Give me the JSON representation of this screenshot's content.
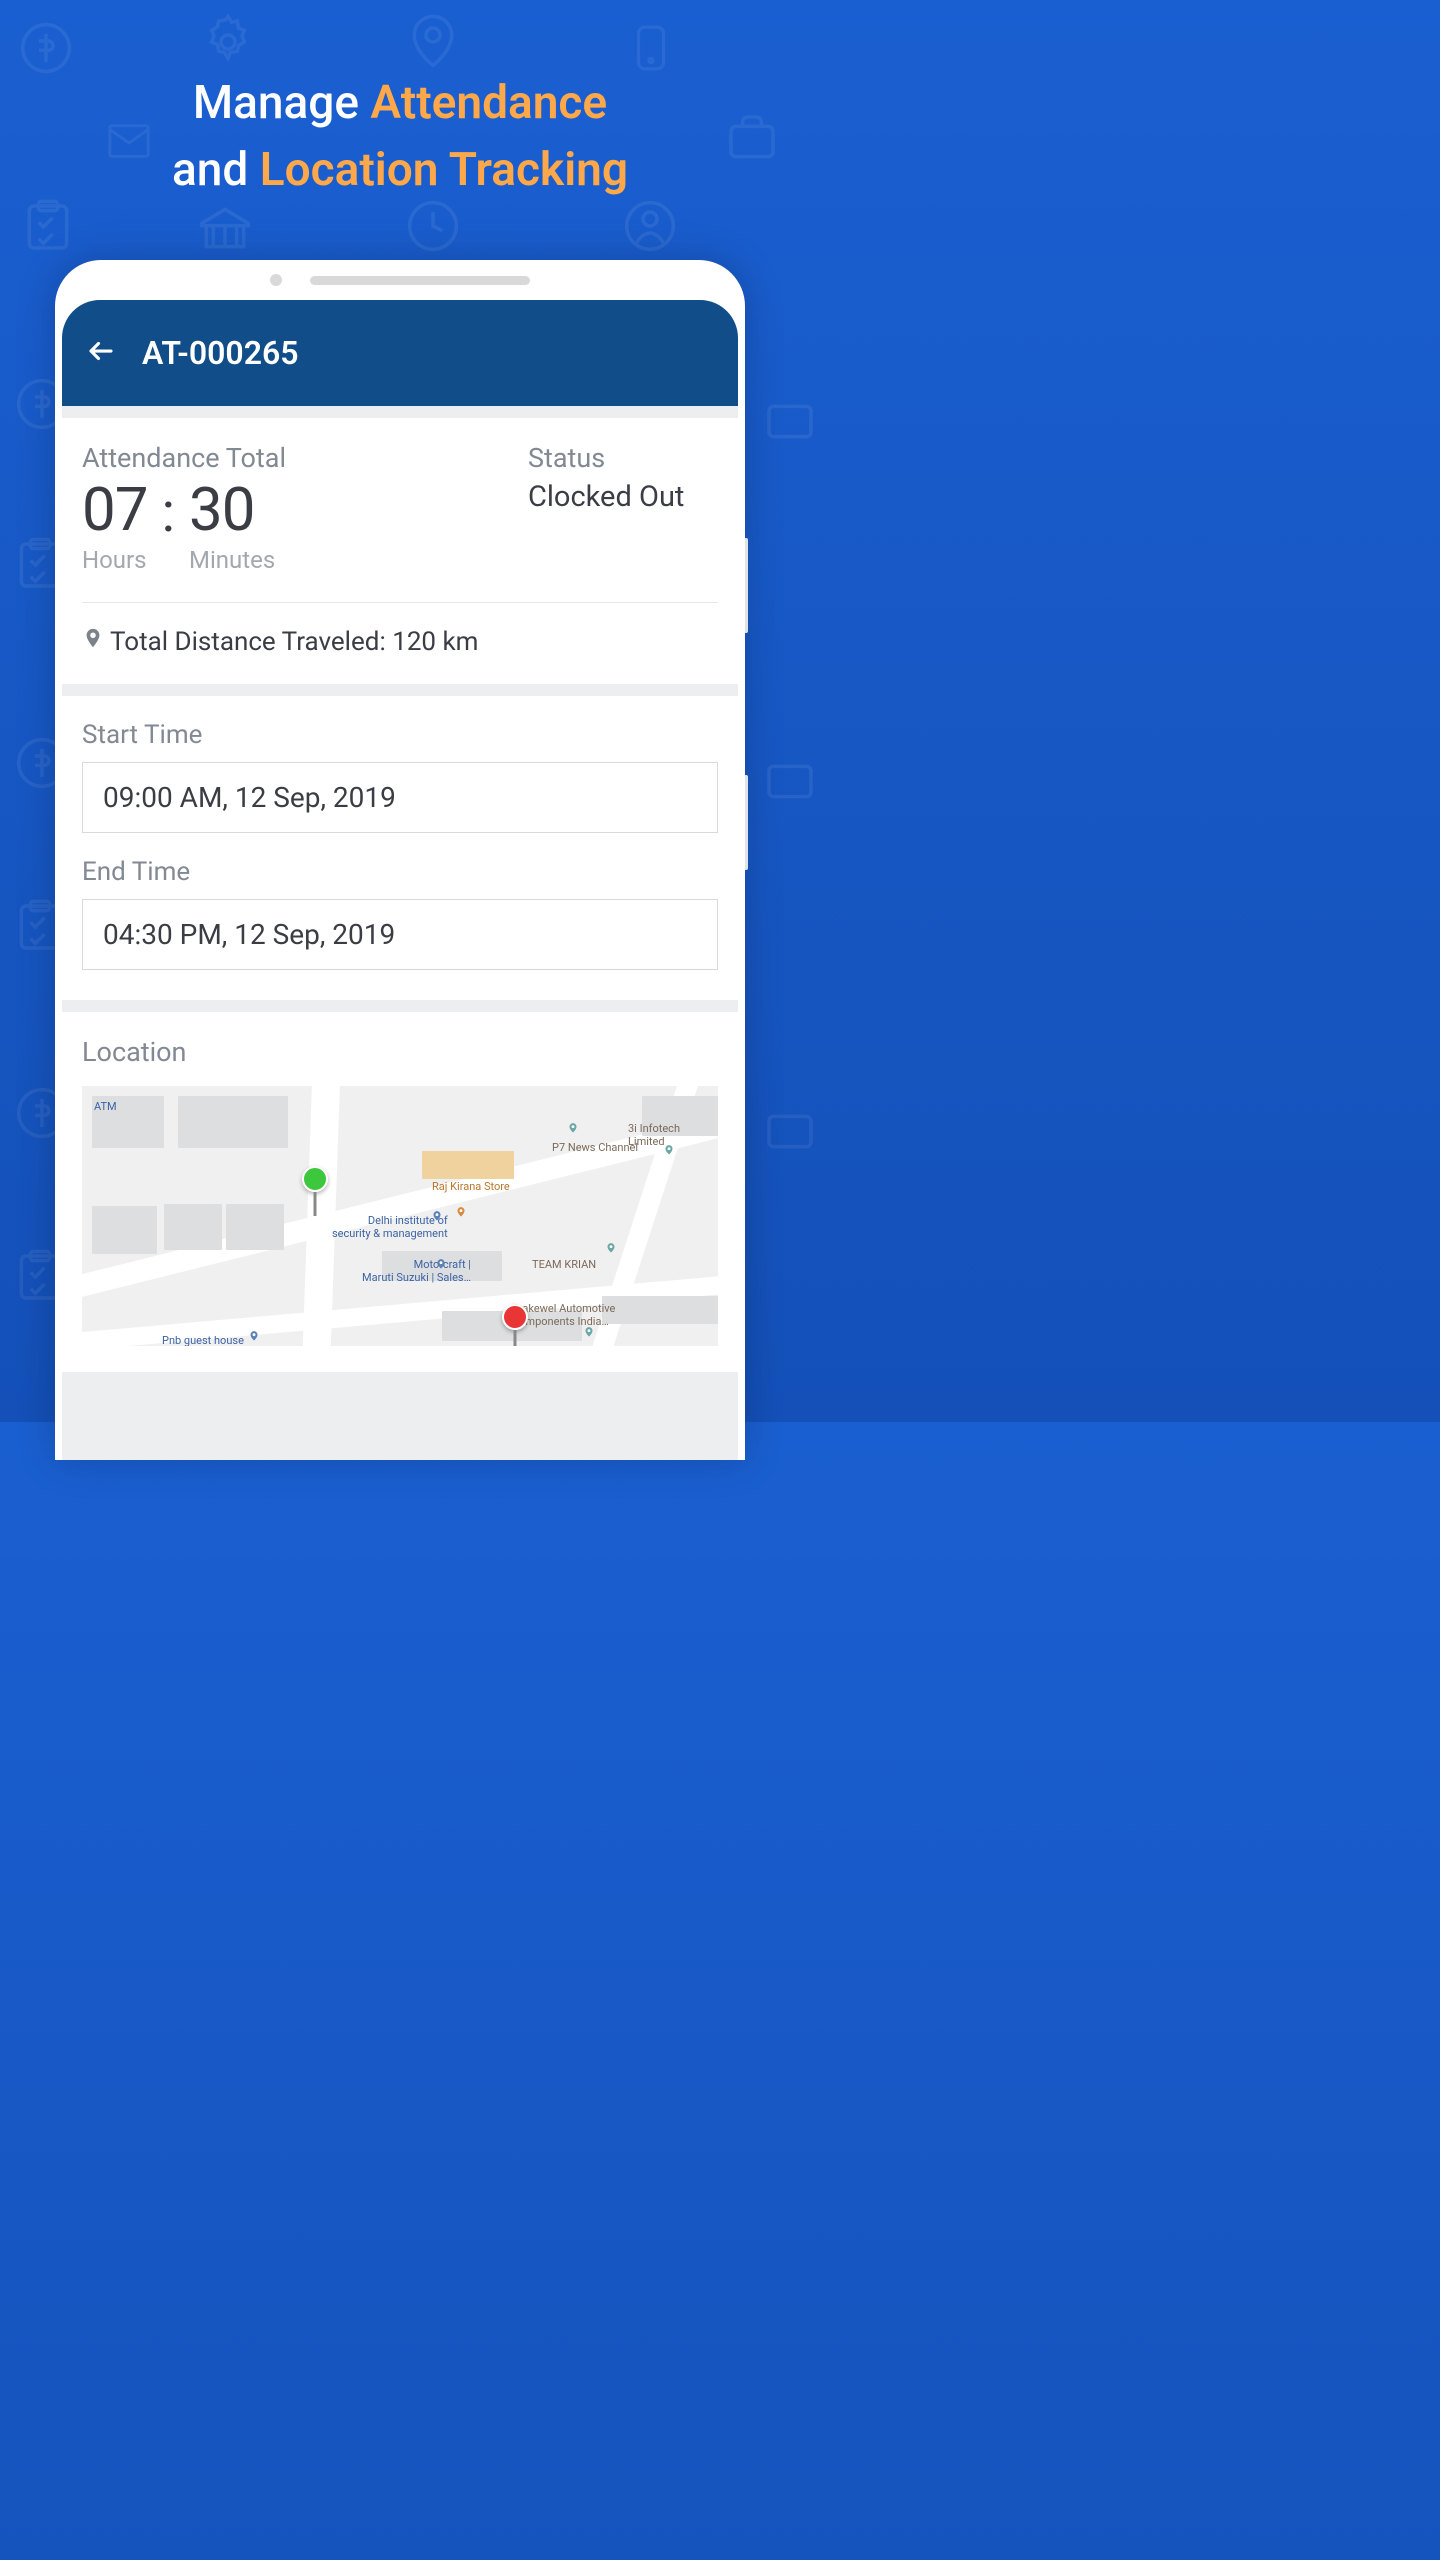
{
  "headline": {
    "p1": "Manage ",
    "h1": "Attendance",
    "p2": "and ",
    "h2": "Location Tracking"
  },
  "appbar": {
    "title": "AT-000265"
  },
  "attendance": {
    "label": "Attendance Total",
    "hours": "07",
    "hours_unit": "Hours",
    "minutes": "30",
    "minutes_unit": "Minutes"
  },
  "status": {
    "label": "Status",
    "value": "Clocked Out"
  },
  "distance": {
    "text": "Total Distance Traveled: 120 km"
  },
  "start": {
    "label": "Start Time",
    "value": "09:00 AM, 12 Sep, 2019"
  },
  "end": {
    "label": "End Time",
    "value": "04:30 PM, 12 Sep, 2019"
  },
  "location": {
    "label": "Location"
  },
  "map": {
    "labels": {
      "atm": "ATM",
      "p7": "P7 News Channel",
      "infotech": "3i Infotech Limited",
      "raj": "Raj Kirana Store",
      "delhi": "Delhi institute of\nsecurity & management",
      "motor": "Motorcraft |\nMaruti Suzuki | Sales…",
      "team": "TEAM KRIAN",
      "brake": "Brakewel Automotive\nComponents India…",
      "pnb": "Pnb guest house"
    }
  }
}
